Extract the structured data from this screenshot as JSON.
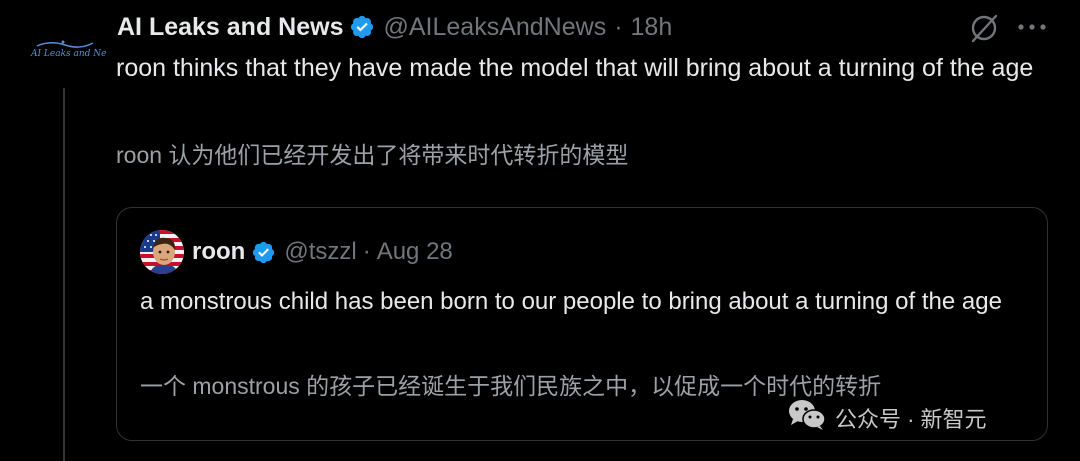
{
  "tweet": {
    "author_name": "AI Leaks and News",
    "author_handle": "@AILeaksAndNews",
    "separator": "·",
    "time": "18h",
    "avatar_logo_text": "AI Leaks and News",
    "text": "roon thinks that they have made the model that will bring about a turning of the age",
    "translation": "roon 认为他们已经开发出了将带来时代转折的模型"
  },
  "quote": {
    "author_name": "roon",
    "author_handle": "@tszzl",
    "separator": "·",
    "date": "Aug 28",
    "text": "a monstrous child has been born to our people to bring about a turning of the age",
    "translation": "一个 monstrous 的孩子已经诞生于我们民族之中，以促成一个时代的转折"
  },
  "watermark": {
    "text": "公众号 · 新智元",
    "icon": "wechat-icon"
  },
  "icons": {
    "verified": "verified-badge-icon",
    "grok": "grok-icon",
    "more": "more-icon"
  },
  "colors": {
    "background": "#000000",
    "text_primary": "#e7e9ea",
    "text_secondary": "#71767b",
    "translation": "#9ba1a6",
    "verified_blue": "#1d9bf0",
    "border": "#2f3336"
  }
}
